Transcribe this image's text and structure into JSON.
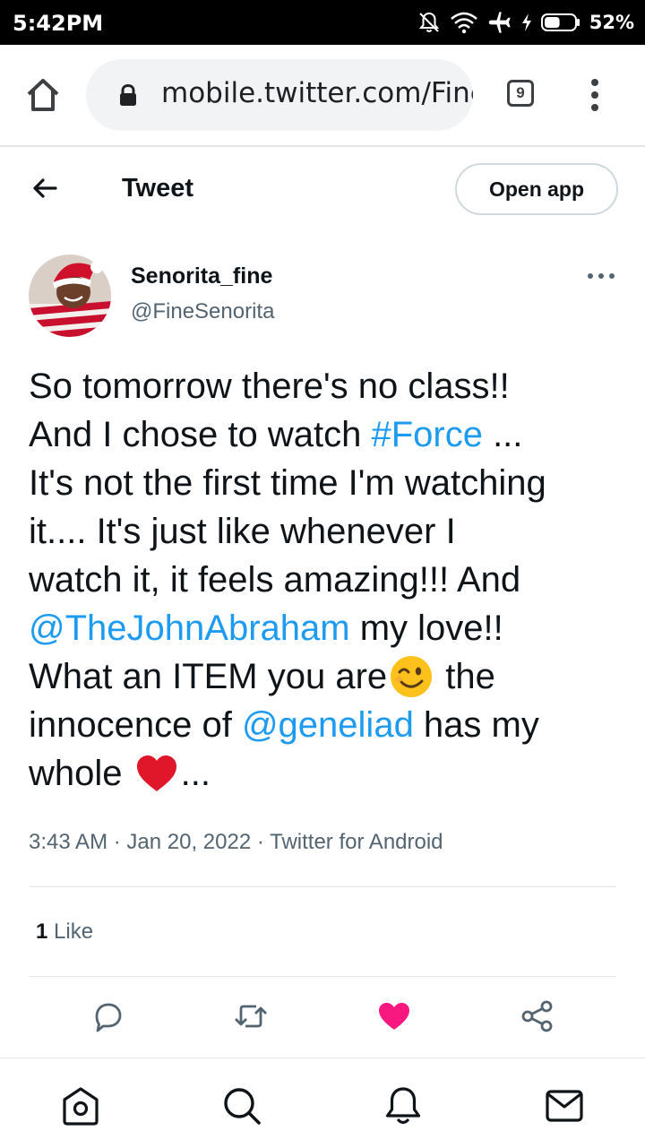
{
  "status_bar": {
    "time": "5:42PM",
    "battery_percent": "52%",
    "battery_level": 0.52,
    "icons": [
      "mute-icon",
      "wifi-icon",
      "airplane-icon",
      "charging-icon",
      "battery-icon"
    ]
  },
  "browser": {
    "url": "mobile.twitter.com/FineSenorita",
    "tab_count": "9",
    "icons": [
      "home-icon",
      "lock-icon",
      "kebab-menu-icon"
    ]
  },
  "header": {
    "title": "Tweet",
    "open_app_label": "Open app",
    "back_icon": "arrow-left-icon"
  },
  "tweet": {
    "author": {
      "display_name": "Senorita_fine",
      "handle": "@FineSenorita"
    },
    "text_lines": [
      [
        {
          "t": "So tomorrow there's no class!!"
        }
      ],
      [
        {
          "t": "And I chose to watch "
        },
        {
          "t": "#Force",
          "link": true
        },
        {
          "t": " ..."
        }
      ],
      [
        {
          "t": "It's not the first time I'm watching"
        }
      ],
      [
        {
          "t": "it.... It's just like whenever I"
        }
      ],
      [
        {
          "t": "watch it, it feels amazing!!! And"
        }
      ],
      [
        {
          "t": "@TheJohnAbraham",
          "link": true
        },
        {
          "t": " my love!!"
        }
      ],
      [
        {
          "t": "What an ITEM you are"
        },
        {
          "emoji": "winking-face"
        },
        {
          "t": " the"
        }
      ],
      [
        {
          "t": "innocence of "
        },
        {
          "t": "@geneliad",
          "link": true
        },
        {
          "t": " has my"
        }
      ],
      [
        {
          "t": "whole "
        },
        {
          "emoji": "red-heart"
        },
        {
          "t": "..."
        }
      ]
    ],
    "time": "3:43 AM",
    "date": "Jan 20, 2022",
    "source": "Twitter for Android",
    "meta_separator": "·",
    "like_count": "1",
    "like_label": "Like",
    "liked": true
  },
  "actions": [
    "reply-icon",
    "retweet-icon",
    "like-icon",
    "share-icon"
  ],
  "bottom_nav": [
    "home-icon",
    "search-icon",
    "notifications-icon",
    "messages-icon"
  ],
  "colors": {
    "link": "#1d9bf0",
    "like": "#f91880",
    "secondary_text": "#536471",
    "status_bar_bg": "#000000"
  }
}
